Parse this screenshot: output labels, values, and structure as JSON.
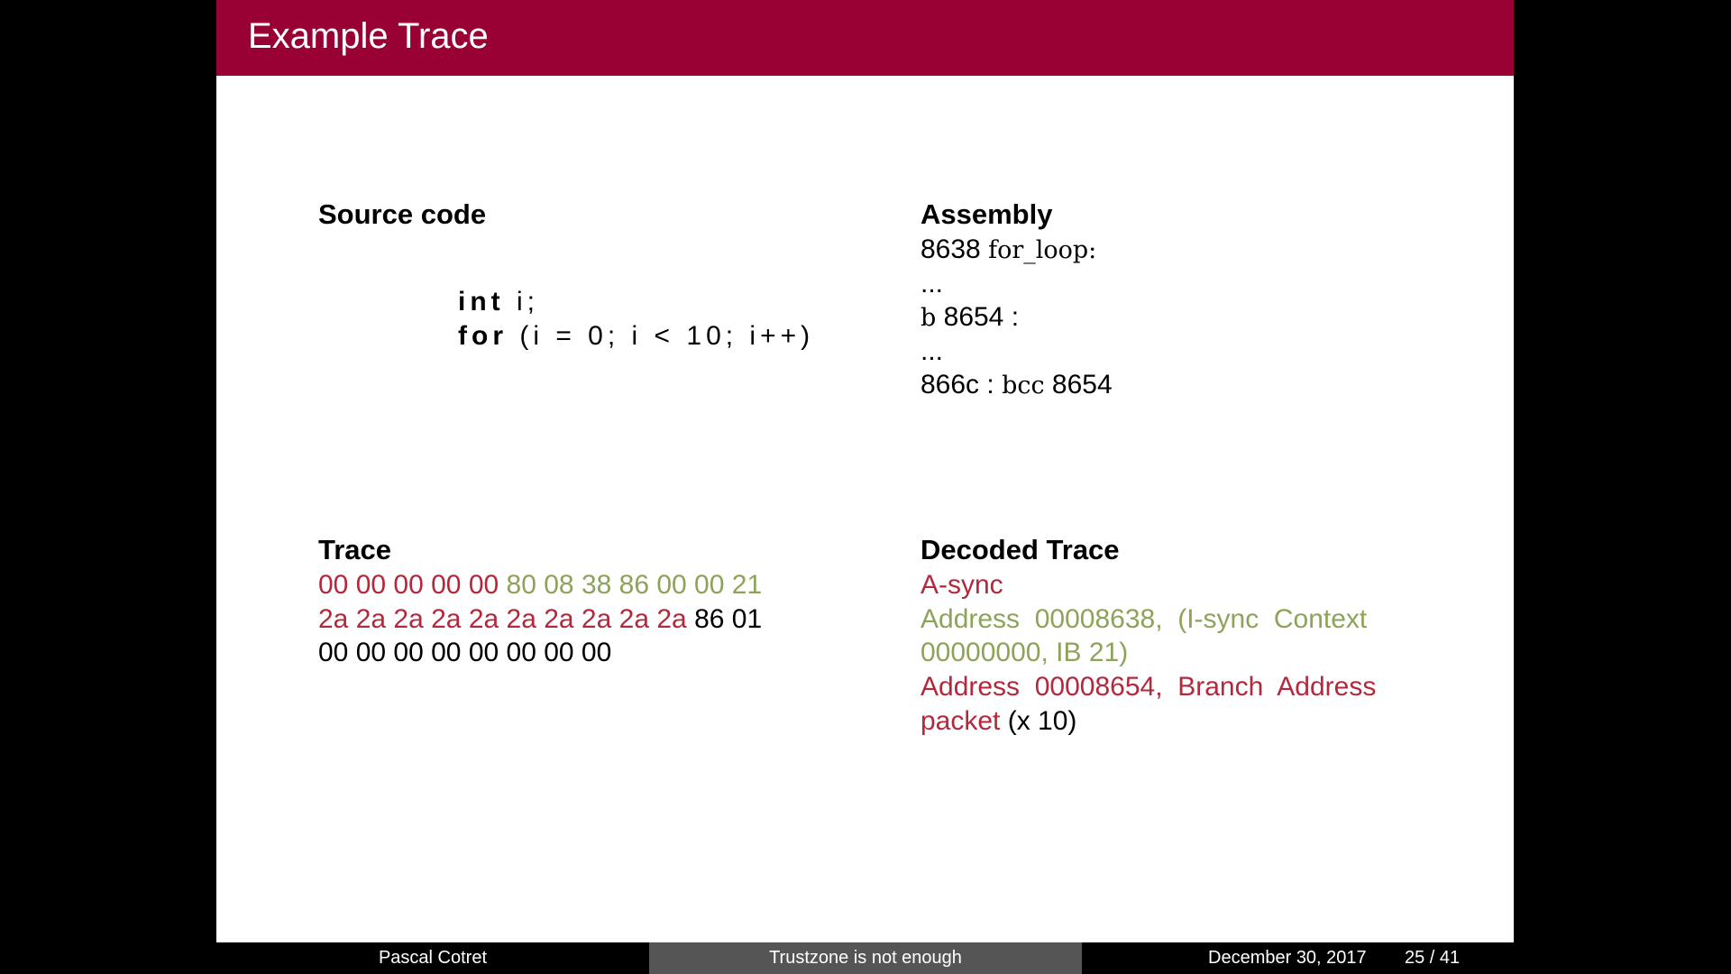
{
  "slide": {
    "title": "Example Trace"
  },
  "source_block": {
    "title": "Source code",
    "code_line1_kw": "int",
    "code_line1_rest": " i;",
    "code_line2_kw": "for",
    "code_line2_rest": " (i = 0; i < 10; i++)"
  },
  "assembly_block": {
    "title": "Assembly",
    "line1_addr": "8638 ",
    "line1_label": "for_loop:",
    "dots1": "...",
    "line3_instr": "b",
    "line3_rest": " 8654 :",
    "dots2": "...",
    "line5_addr": "866c : ",
    "line5_instr": "bcc",
    "line5_rest": " 8654"
  },
  "trace_block": {
    "title": "Trace",
    "line1_red": "00 00 00 00 00",
    "line1_green": "80 08 38 86 00 00 21",
    "line2_red": "2a 2a 2a 2a 2a 2a 2a 2a 2a 2a",
    "line2_black": "86 01",
    "line3_black": "00 00 00 00 00 00 00 00"
  },
  "decoded_block": {
    "title": "Decoded Trace",
    "line1_red": "A-sync",
    "line2_green": "Address  00008638,  (I-sync  Context",
    "line3_green": "00000000, IB 21)",
    "line4_red": "Address  00008654,  Branch  Address",
    "line5_red": "packet",
    "line5_black": " (x 10)"
  },
  "footer": {
    "author": "Pascal Cotret",
    "talk_title": "Trustzone is not enough",
    "date": "December 30, 2017",
    "page": "25 / 41"
  },
  "colors": {
    "title_bar": "#990033",
    "red_text": "#b3283c",
    "green_text": "#8ea35a",
    "footer_mid": "#555555"
  }
}
